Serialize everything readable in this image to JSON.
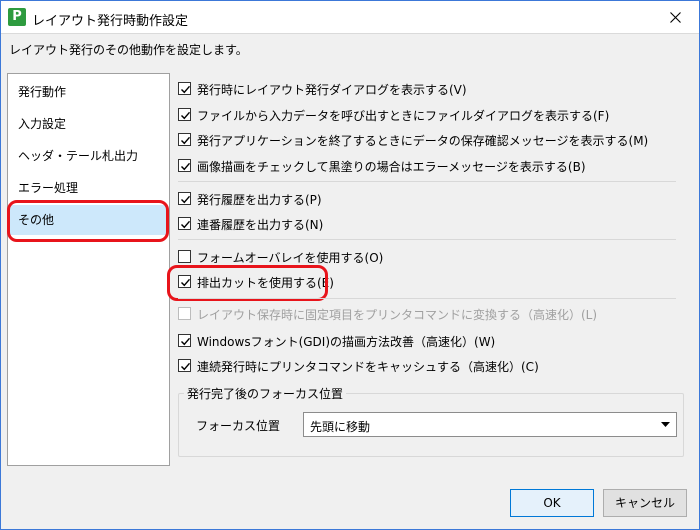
{
  "window": {
    "title": "レイアウト発行時動作設定",
    "app_icon_letter": "P",
    "description": "レイアウト発行のその他動作を設定します。"
  },
  "sidebar": {
    "items": [
      {
        "label": "発行動作"
      },
      {
        "label": "入力設定"
      },
      {
        "label": "ヘッダ・テール札出力"
      },
      {
        "label": "エラー処理"
      },
      {
        "label": "その他",
        "selected": true
      }
    ]
  },
  "options": [
    {
      "label": "発行時にレイアウト発行ダイアログを表示する(V)",
      "checked": true,
      "enabled": true
    },
    {
      "label": "ファイルから入力データを呼び出すときにファイルダイアログを表示する(F)",
      "checked": true,
      "enabled": true
    },
    {
      "label": "発行アプリケーションを終了するときにデータの保存確認メッセージを表示する(M)",
      "checked": true,
      "enabled": true
    },
    {
      "label": "画像描画をチェックして黒塗りの場合はエラーメッセージを表示する(B)",
      "checked": true,
      "enabled": true
    },
    {
      "label": "発行履歴を出力する(P)",
      "checked": true,
      "enabled": true
    },
    {
      "label": "連番履歴を出力する(N)",
      "checked": true,
      "enabled": true
    },
    {
      "label": "フォームオーバレイを使用する(O)",
      "checked": false,
      "enabled": true
    },
    {
      "label": "排出カットを使用する(E)",
      "checked": true,
      "enabled": true
    },
    {
      "label": "レイアウト保存時に固定項目をプリンタコマンドに変換する（高速化）(L)",
      "checked": false,
      "enabled": false
    },
    {
      "label": "Windowsフォント(GDI)の描画方法改善（高速化）(W)",
      "checked": true,
      "enabled": true
    },
    {
      "label": "連続発行時にプリンタコマンドをキャッシュする（高速化）(C)",
      "checked": true,
      "enabled": true
    }
  ],
  "focus_group": {
    "title": "発行完了後のフォーカス位置",
    "label": "フォーカス位置",
    "selected": "先頭に移動"
  },
  "buttons": {
    "ok": "OK",
    "cancel": "キャンセル"
  },
  "colors": {
    "highlight": "#e8141b",
    "selection": "#cde8fb",
    "app_icon": "#2e9b3f",
    "ok_border": "#0078d7"
  }
}
